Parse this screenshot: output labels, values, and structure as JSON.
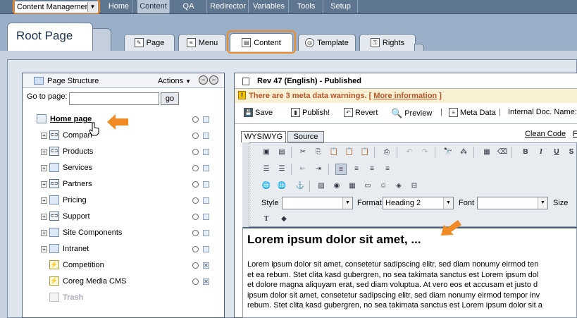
{
  "topnav": {
    "selector_value": "Content Managemen",
    "items": [
      "Home",
      "Content",
      "QA",
      "Redirector",
      "Variables",
      "Tools",
      "Setup"
    ],
    "active": "Content"
  },
  "page_tabs": {
    "root_title": "Root Page",
    "tabs": [
      "Page",
      "Menu",
      "Content",
      "Template",
      "Rights"
    ],
    "active": "Content"
  },
  "structure": {
    "title": "Page Structure",
    "actions_label": "Actions",
    "goto_label": "Go to page:",
    "goto_value": "",
    "go_button": "go",
    "tree": [
      {
        "label": "Home page",
        "type": "home",
        "bold": true
      },
      {
        "label": "Compan",
        "type": "link",
        "expander": true
      },
      {
        "label": "Products",
        "type": "link",
        "expander": true
      },
      {
        "label": "Services",
        "type": "page",
        "expander": true
      },
      {
        "label": "Partners",
        "type": "link",
        "expander": true
      },
      {
        "label": "Pricing",
        "type": "page",
        "expander": true
      },
      {
        "label": "Support",
        "type": "link",
        "expander": true
      },
      {
        "label": "Site Components",
        "type": "page",
        "expander": true
      },
      {
        "label": "Intranet",
        "type": "page",
        "expander": true
      },
      {
        "label": "Competition",
        "type": "bolt",
        "expander": false,
        "checked": true
      },
      {
        "label": "Coreg Media CMS",
        "type": "bolt",
        "expander": false,
        "checked": true
      },
      {
        "label": "Trash",
        "type": "trash",
        "expander": false
      }
    ]
  },
  "editor": {
    "revision_title": "Rev 47 (English) - Published",
    "warning_text": "There are 3 meta data warnings. [",
    "warning_link": "More information",
    "warning_close": "]",
    "buttons": {
      "save": "Save",
      "publish": "Publish!",
      "revert": "Revert",
      "preview": "Preview",
      "meta": "Meta Data",
      "internal": "Internal Doc. Name:"
    },
    "subtabs": [
      "WYSIWYG",
      "Source"
    ],
    "clean_code": "Clean Code",
    "style_label": "Style",
    "style_value": "",
    "format_label": "Format",
    "format_value": "Heading 2",
    "font_label": "Font",
    "font_value": "",
    "size_label": "Size",
    "heading": "Lorem ipsum dolor sit amet, ...",
    "body_lines": [
      "Lorem ipsum dolor sit amet, consetetur sadipscing elitr, sed diam nonumy eirmod ten",
      "et ea rebum. Stet clita kasd gubergren, no sea takimata sanctus est Lorem ipsum dol",
      "et dolore magna aliquyam erat, sed diam voluptua. At vero eos et accusam et justo d",
      "ipsum dolor sit amet, consetetur sadipscing elitr, sed diam nonumy eirmod tempor inv",
      "rebum. Stet clita kasd gubergren, no sea takimata sanctus est Lorem ipsum dolor sit a"
    ]
  },
  "colors": {
    "highlight": "#f08a24",
    "nav_bg": "#5f7691",
    "warning_text": "#c0542a"
  }
}
